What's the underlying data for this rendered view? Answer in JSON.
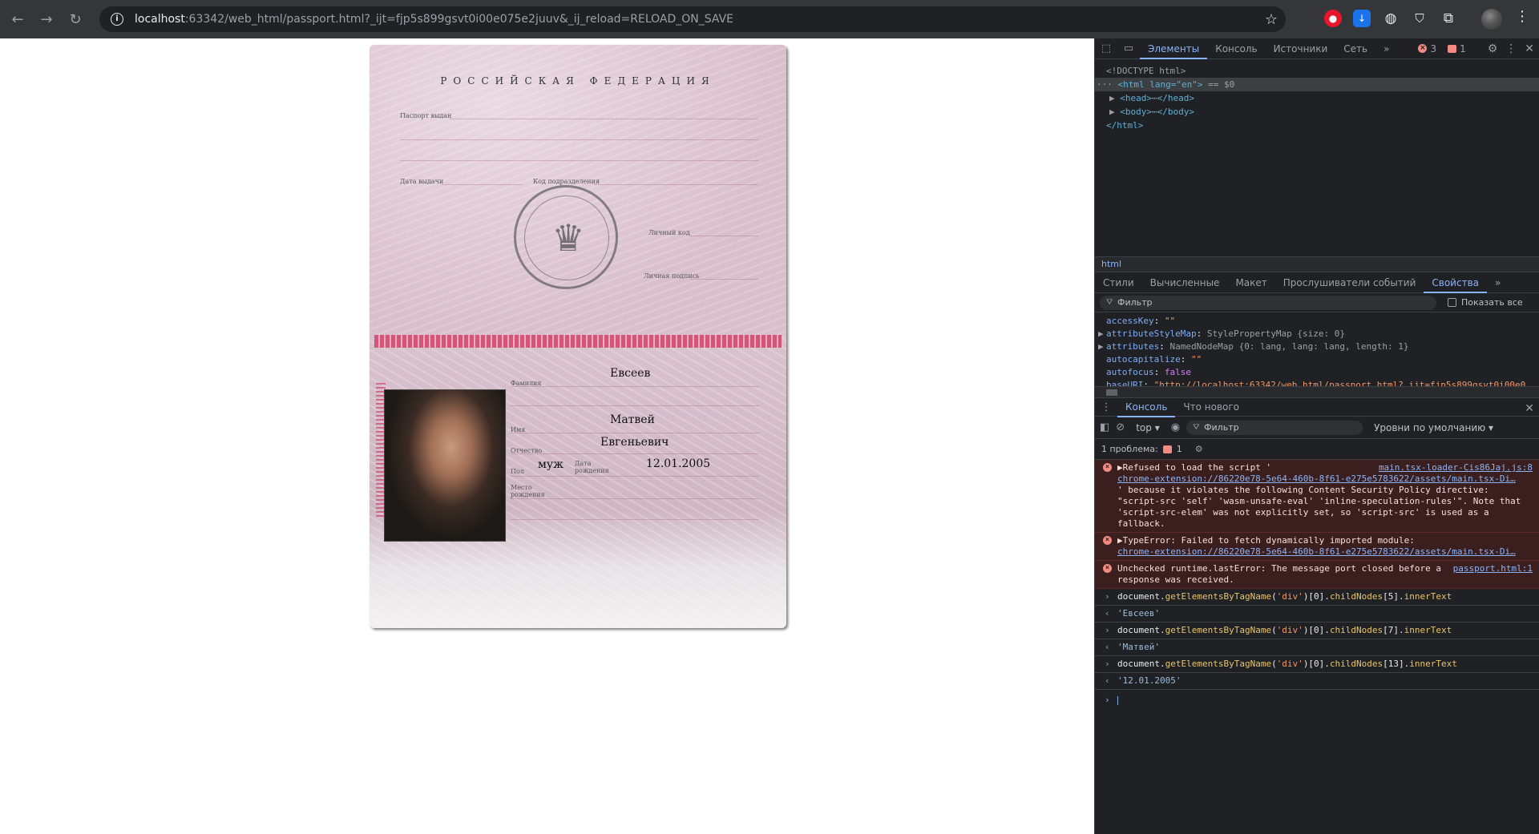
{
  "browser": {
    "url_host": "localhost",
    "url_rest": ":63342/web_html/passport.html?_ijt=fjp5s899gsvt0i00e075e2juuv&_ij_reload=RELOAD_ON_SAVE",
    "icons": [
      "back-icon",
      "forward-icon",
      "reload-icon",
      "info-icon",
      "star-icon",
      "extension-icon",
      "kebab-icon"
    ]
  },
  "passport": {
    "country": "РОССИЙСКАЯ ФЕДЕРАЦИЯ",
    "labels": {
      "issued_by": "Паспорт выдан",
      "issue_date": "Дата выдачи",
      "division_code": "Код подразделения",
      "personal_code": "Личный код",
      "signature": "Личная подпись",
      "surname": "Фамилия",
      "name": "Имя",
      "patronymic": "Отчество",
      "sex": "Пол",
      "birth_date": "Дата рождения",
      "birth_place": "Место рождения"
    },
    "surname": "Евсеев",
    "name": "Матвей",
    "patronymic": "Евгеньевич",
    "sex": "муж",
    "birth_date": "12.01.2005"
  },
  "devtools": {
    "tabs": [
      "Элементы",
      "Консоль",
      "Источники",
      "Сеть"
    ],
    "active_tab": "Элементы",
    "error_count": "3",
    "issue_count": "1",
    "dom": {
      "doctype": "<!DOCTYPE html>",
      "html_open": "<html lang=\"en\">",
      "selected_marker": "== $0",
      "head": "<head>",
      "head_close": "</head>",
      "body": "<body>",
      "body_close": "</body>",
      "html_close": "</html>"
    },
    "breadcrumb": "html",
    "subtabs": [
      "Стили",
      "Вычисленные",
      "Макет",
      "Прослушиватели событий",
      "Свойства"
    ],
    "active_subtab": "Свойства",
    "filter_placeholder": "Фильтр",
    "show_all": "Показать все",
    "properties": [
      {
        "key": "accessKey",
        "value": "\"\"",
        "kind": "string"
      },
      {
        "key": "attributeStyleMap",
        "value": "StylePropertyMap {size: 0}",
        "kind": "object"
      },
      {
        "key": "attributes",
        "value": "NamedNodeMap {0: lang, lang: lang, length: 1}",
        "kind": "object"
      },
      {
        "key": "autocapitalize",
        "value": "\"\"",
        "kind": "string"
      },
      {
        "key": "autofocus",
        "value": "false",
        "kind": "bool"
      },
      {
        "key": "baseURI",
        "value": "\"http://localhost:63342/web_html/passport.html?_ijt=fjp5s899gsvt0i00e0",
        "kind": "string"
      }
    ],
    "drawer_tabs": [
      "Консоль",
      "Что нового"
    ],
    "context": "top",
    "console_filter": "Фильтр",
    "levels": "Уровни по умолчанию",
    "issues_label": "1 проблема:",
    "issues_count": "1",
    "console": {
      "err1_src": "main.tsx-loader-Cis86Jaj.js:8",
      "err1_pre": "Refused to load the script '",
      "err1_link": "chrome-extension://86220e78-5e64-460b-8f61-e275e5783622/assets/main.tsx-Di…",
      "err1_post": "' because it violates the following Content Security Policy directive: \"script-src 'self' 'wasm-unsafe-eval' 'inline-speculation-rules'\". Note that 'script-src-elem' was not explicitly set, so 'script-src' is used as a fallback.",
      "err2_pre": "TypeError: Failed to fetch dynamically imported module:",
      "err2_link": "chrome-extension://86220e78-5e64-460b-8f61-e275e5783622/assets/main.tsx-Di…",
      "err3_text": "Unchecked runtime.lastError: The message port closed before a response was received.",
      "err3_src": "passport.html:1",
      "cmds": [
        {
          "obj": "document.",
          "fn": "getElementsByTagName",
          "arg": "'div'",
          "tail1": ")[0].",
          "prop1": "childNodes",
          "idx": "[5].",
          "prop2": "innerText",
          "result": "'Евсеев'"
        },
        {
          "obj": "document.",
          "fn": "getElementsByTagName",
          "arg": "'div'",
          "tail1": ")[0].",
          "prop1": "childNodes",
          "idx": "[7].",
          "prop2": "innerText",
          "result": "'Матвей'"
        },
        {
          "obj": "document.",
          "fn": "getElementsByTagName",
          "arg": "'div'",
          "tail1": ")[0].",
          "prop1": "childNodes",
          "idx": "[13].",
          "prop2": "innerText",
          "result": "'12.01.2005'"
        }
      ]
    }
  }
}
